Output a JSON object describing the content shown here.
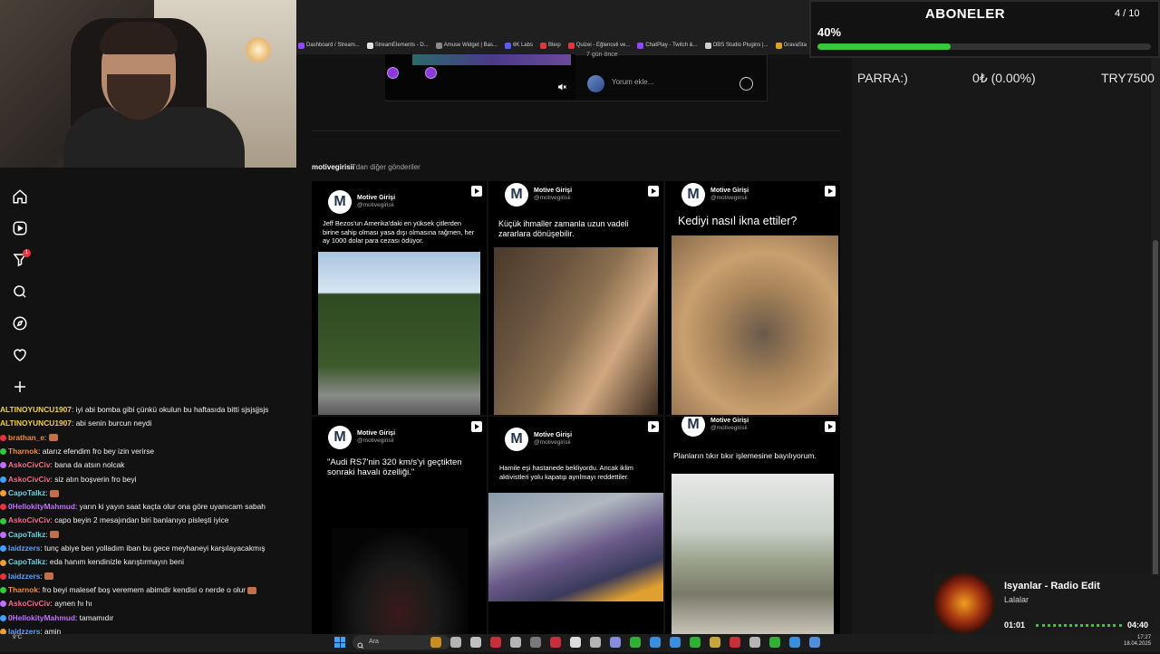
{
  "bookmarks": [
    {
      "label": "Dashboard / Stream...",
      "color": "#9146ff"
    },
    {
      "label": "StreamElements - D...",
      "color": "#e5e5e5"
    },
    {
      "label": "Amuse Widget | Bas...",
      "color": "#8a8a8a"
    },
    {
      "label": "6K Labs",
      "color": "#5a5aff"
    },
    {
      "label": "Bleıp",
      "color": "#e5333f"
    },
    {
      "label": "Quizei - Eğlenceli ve...",
      "color": "#e5333f"
    },
    {
      "label": "ChatPlay - Twitch &...",
      "color": "#9146ff"
    },
    {
      "label": "OBS Studio Plugins |...",
      "color": "#cfcfcf"
    },
    {
      "label": "GravaSta",
      "color": "#e0a020"
    }
  ],
  "post": {
    "time_label": "7 gün önce",
    "comment_placeholder": "Yorum ekle..."
  },
  "more_posts": {
    "account": "motivegirisii",
    "suffix": "'dan diğer gönderiler"
  },
  "cards": [
    {
      "account_name": "Motive Girişi",
      "handle": "@motivegirisii",
      "text": "Jeff Bezos'un Amerika'daki en yüksek çitlerden birine sahip olması yasa dışı olmasına rağmen, her ay 1000 dolar para cezası ödüyor."
    },
    {
      "account_name": "Motive Girişi",
      "handle": "@motivegirisii",
      "text": "Küçük ihmaller zamanla uzun vadeli zararlara dönüşebilir."
    },
    {
      "account_name": "Motive Girişi",
      "handle": "@motivegirisii",
      "text": "Kediyi nasıl ikna ettiler?"
    },
    {
      "account_name": "Motive Girişi",
      "handle": "@motivegirisii",
      "text": "\"Audi RS7'nin 320 km/s'yi geçtikten sonraki havalı özelliği.\""
    },
    {
      "account_name": "Motive Girişi",
      "handle": "@motivegirisii",
      "text": "Hamile eşi hastanede bekliyordu. Ancak iklim aktivistleri yolu kapatıp ayrılmayı reddettiler."
    },
    {
      "account_name": "Motive Girişi",
      "handle": "@motivegirisii",
      "text": "Planların tıkır tıkır işlemesine bayılıyorum."
    }
  ],
  "subscriber_goal": {
    "title": "ABONELER",
    "count": "4 / 10",
    "percent_label": "40%",
    "progress": 0.4
  },
  "donation_goal": {
    "label": "PARRA:)",
    "value": "0₺ (0.00%)",
    "goal": "TRY7500"
  },
  "now_playing": {
    "title": "Isyanlar - Radio Edit",
    "artist": "Lalalar",
    "elapsed": "01:01",
    "duration": "04:40",
    "progress": 0.22
  },
  "chat": [
    {
      "user": "ALTINOYUNCU1907",
      "color": "#f2d04a",
      "msg": ": iyi abi bomba gibi çünkü okulun bu haftasıda bitti sjsjsjjsjs",
      "emote": false
    },
    {
      "user": "ALTINOYUNCU1907",
      "color": "#f2d04a",
      "msg": ": abi senin burcun neydi",
      "emote": false
    },
    {
      "user": "brathan_e",
      "color": "#f08a3a",
      "msg": ":",
      "emote": true
    },
    {
      "user": "Tharnok",
      "color": "#f08a3a",
      "msg": ": atarız efendim fro bey izin verirse",
      "emote": false
    },
    {
      "user": "AskoCivCiv",
      "color": "#f06a8a",
      "msg": ": bana da atsın nolcak",
      "emote": false
    },
    {
      "user": "AskoCivCiv",
      "color": "#f06a8a",
      "msg": ": siz atın boşverin fro beyi",
      "emote": false
    },
    {
      "user": "CapoTalkz",
      "color": "#6ad0e0",
      "msg": ":",
      "emote": true
    },
    {
      "user": "0HellokityMahmud",
      "color": "#c070ff",
      "msg": ": yarın ki yayın saat kaçta olur ona göre uyanıcam sabah",
      "emote": false
    },
    {
      "user": "AskoCivCiv",
      "color": "#f06a8a",
      "msg": ": capo beyin 2 mesajından biri banlanıyo pisleşti iyice",
      "emote": false
    },
    {
      "user": "CapoTalkz",
      "color": "#6ad0e0",
      "msg": ":",
      "emote": true
    },
    {
      "user": "laidzzers",
      "color": "#5aa0ff",
      "msg": ": tunç abiye ben yolladım iban bu gece meyhaneyi karşılayacakmış",
      "emote": false
    },
    {
      "user": "CapoTalkz",
      "color": "#6ad0e0",
      "msg": ": eda hanım kendinizle karıştırmayın beni",
      "emote": false
    },
    {
      "user": "laidzzers",
      "color": "#5aa0ff",
      "msg": ":",
      "emote": true
    },
    {
      "user": "Tharnok",
      "color": "#f08a3a",
      "msg": ": fro beyi malesef boş veremem abimdir kendisi o nerde o olur",
      "emote": true
    },
    {
      "user": "AskoCivCiv",
      "color": "#f06a8a",
      "msg": ": aynen hı hı",
      "emote": false
    },
    {
      "user": "0HellokityMahmud",
      "color": "#c070ff",
      "msg": ": tamamıdır",
      "emote": false
    },
    {
      "user": "laidzzers",
      "color": "#5aa0ff",
      "msg": ": amin",
      "emote": false
    },
    {
      "user": "CapoTalkz",
      "color": "#6ad0e0",
      "msg": ":",
      "emote": true
    }
  ],
  "taskbar": {
    "search_placeholder": "Ara",
    "weather": "9°C",
    "time": "17:27",
    "date": "18.04.2025"
  },
  "icons": [
    "home-icon",
    "reels-icon",
    "filter-icon",
    "search-icon",
    "explore-icon",
    "heart-icon",
    "plus-icon"
  ]
}
